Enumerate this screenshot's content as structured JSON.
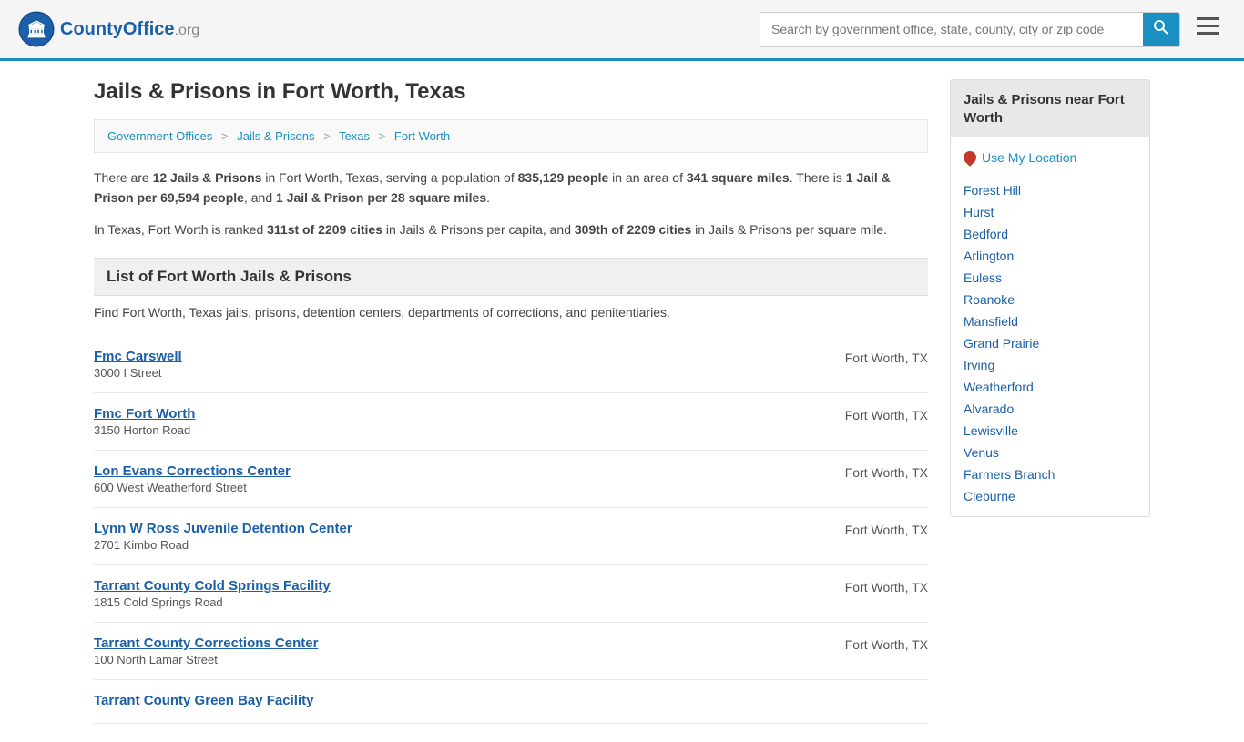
{
  "header": {
    "logo_text": "CountyOffice",
    "logo_suffix": ".org",
    "search_placeholder": "Search by government office, state, county, city or zip code",
    "search_btn_label": "🔍"
  },
  "page": {
    "title": "Jails & Prisons in Fort Worth, Texas",
    "intro": {
      "line1_pre": "There are ",
      "count": "12 Jails & Prisons",
      "line1_mid": " in Fort Worth, Texas, serving a population of ",
      "population": "835,129 people",
      "line1_mid2": " in an area of ",
      "area": "341 square miles",
      "line1_post": ". There is ",
      "per_capita": "1 Jail & Prison per 69,594 people",
      "line1_end": ", and ",
      "per_sqmile": "1 Jail & Prison per 28 square miles",
      "line1_final": ".",
      "rank_pre": "In Texas, Fort Worth is ranked ",
      "rank1": "311st of 2209 cities",
      "rank_mid": " in Jails & Prisons per capita, and ",
      "rank2": "309th of 2209 cities",
      "rank_post": " in Jails & Prisons per square mile."
    },
    "list_heading": "List of Fort Worth Jails & Prisons",
    "list_desc": "Find Fort Worth, Texas jails, prisons, detention centers, departments of corrections, and penitentiaries."
  },
  "breadcrumb": {
    "items": [
      {
        "label": "Government Offices",
        "href": "#"
      },
      {
        "label": "Jails & Prisons",
        "href": "#"
      },
      {
        "label": "Texas",
        "href": "#"
      },
      {
        "label": "Fort Worth",
        "href": "#"
      }
    ]
  },
  "prisons": [
    {
      "name": "Fmc Carswell",
      "address": "3000 I Street",
      "city": "Fort Worth, TX"
    },
    {
      "name": "Fmc Fort Worth",
      "address": "3150 Horton Road",
      "city": "Fort Worth, TX"
    },
    {
      "name": "Lon Evans Corrections Center",
      "address": "600 West Weatherford Street",
      "city": "Fort Worth, TX"
    },
    {
      "name": "Lynn W Ross Juvenile Detention Center",
      "address": "2701 Kimbo Road",
      "city": "Fort Worth, TX"
    },
    {
      "name": "Tarrant County Cold Springs Facility",
      "address": "1815 Cold Springs Road",
      "city": "Fort Worth, TX"
    },
    {
      "name": "Tarrant County Corrections Center",
      "address": "100 North Lamar Street",
      "city": "Fort Worth, TX"
    },
    {
      "name": "Tarrant County Green Bay Facility",
      "address": "",
      "city": ""
    }
  ],
  "sidebar": {
    "title": "Jails & Prisons near Fort Worth",
    "use_location": "Use My Location",
    "nearby_cities": [
      "Forest Hill",
      "Hurst",
      "Bedford",
      "Arlington",
      "Euless",
      "Roanoke",
      "Mansfield",
      "Grand Prairie",
      "Irving",
      "Weatherford",
      "Alvarado",
      "Lewisville",
      "Venus",
      "Farmers Branch",
      "Cleburne"
    ]
  }
}
